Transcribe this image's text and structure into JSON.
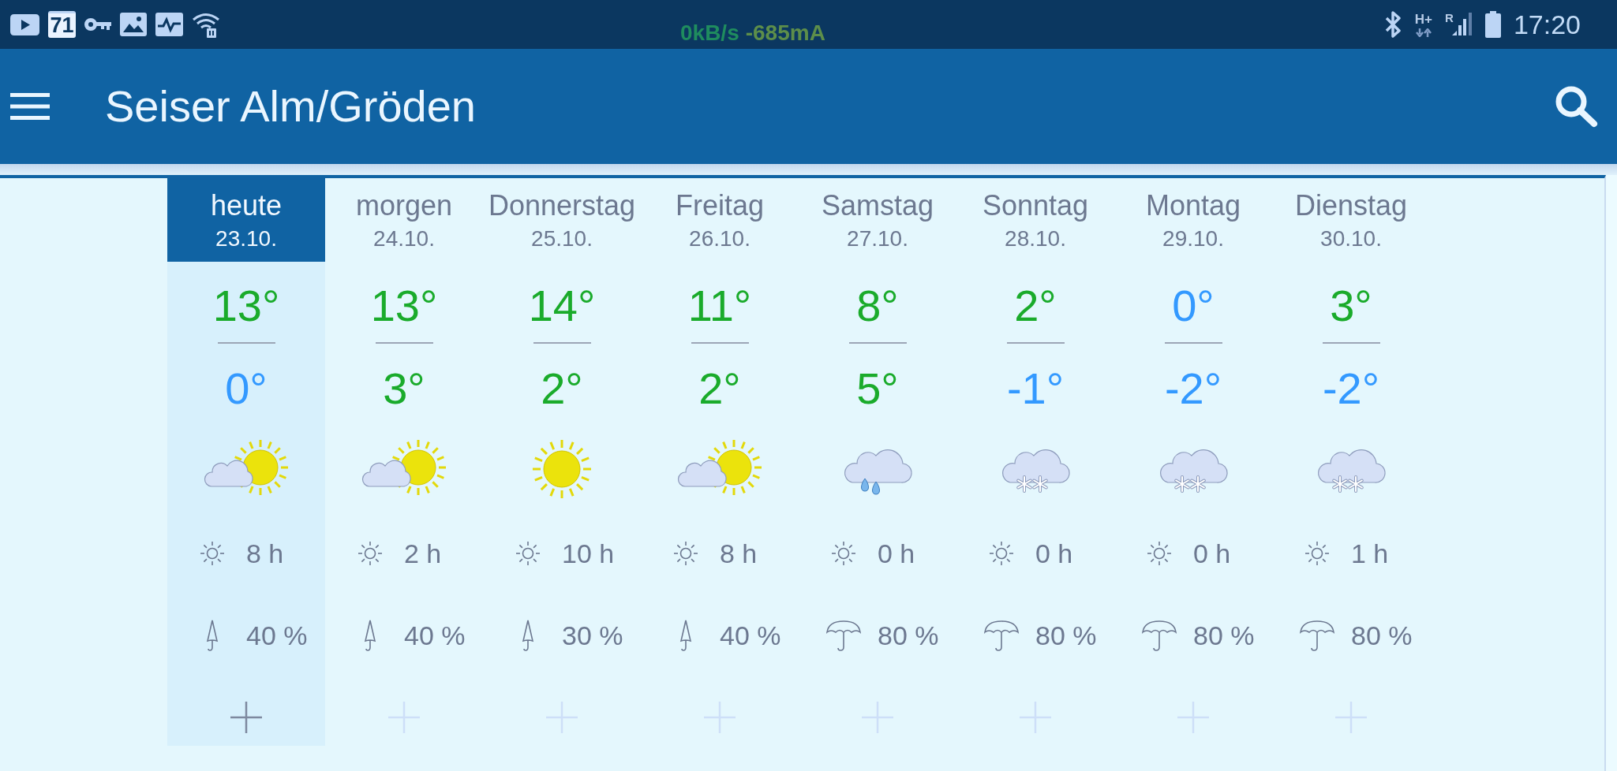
{
  "status_bar": {
    "calendar_day": "71",
    "network_speed": "0kB/s",
    "current_draw": "-685mA",
    "network_type": "H+",
    "roaming": "R",
    "time": "17:20"
  },
  "app_bar": {
    "title": "Seiser Alm/Gröden"
  },
  "forecast": {
    "days": [
      {
        "name": "heute",
        "date": "23.10.",
        "selected": true,
        "high": {
          "text": "13°",
          "color": "#1aab2b"
        },
        "low": {
          "text": "0°",
          "color": "#3399ff"
        },
        "weather_icon": {
          "kind": "partly-sunny"
        },
        "sunshine": "8 h",
        "precipitation": {
          "kind": "closed",
          "text": "40 %"
        }
      },
      {
        "name": "morgen",
        "date": "24.10.",
        "selected": false,
        "high": {
          "text": "13°",
          "color": "#1aab2b"
        },
        "low": {
          "text": "3°",
          "color": "#1aab2b"
        },
        "weather_icon": {
          "kind": "partly-sunny"
        },
        "sunshine": "2 h",
        "precipitation": {
          "kind": "closed",
          "text": "40 %"
        }
      },
      {
        "name": "Donnerstag",
        "date": "25.10.",
        "selected": false,
        "high": {
          "text": "14°",
          "color": "#1aab2b"
        },
        "low": {
          "text": "2°",
          "color": "#1aab2b"
        },
        "weather_icon": {
          "kind": "sunny"
        },
        "sunshine": "10 h",
        "precipitation": {
          "kind": "closed",
          "text": "30 %"
        }
      },
      {
        "name": "Freitag",
        "date": "26.10.",
        "selected": false,
        "high": {
          "text": "11°",
          "color": "#1aab2b"
        },
        "low": {
          "text": "2°",
          "color": "#1aab2b"
        },
        "weather_icon": {
          "kind": "partly-sunny"
        },
        "sunshine": "8 h",
        "precipitation": {
          "kind": "closed",
          "text": "40 %"
        }
      },
      {
        "name": "Samstag",
        "date": "27.10.",
        "selected": false,
        "high": {
          "text": "8°",
          "color": "#1aab2b"
        },
        "low": {
          "text": "5°",
          "color": "#1aab2b"
        },
        "weather_icon": {
          "kind": "rain"
        },
        "sunshine": "0 h",
        "precipitation": {
          "kind": "open",
          "text": "80 %"
        }
      },
      {
        "name": "Sonntag",
        "date": "28.10.",
        "selected": false,
        "high": {
          "text": "2°",
          "color": "#1aab2b"
        },
        "low": {
          "text": "-1°",
          "color": "#3399ff"
        },
        "weather_icon": {
          "kind": "snow"
        },
        "sunshine": "0 h",
        "precipitation": {
          "kind": "open",
          "text": "80 %"
        }
      },
      {
        "name": "Montag",
        "date": "29.10.",
        "selected": false,
        "high": {
          "text": "0°",
          "color": "#3399ff"
        },
        "low": {
          "text": "-2°",
          "color": "#3399ff"
        },
        "weather_icon": {
          "kind": "snow"
        },
        "sunshine": "0 h",
        "precipitation": {
          "kind": "open",
          "text": "80 %"
        }
      },
      {
        "name": "Dienstag",
        "date": "30.10.",
        "selected": false,
        "high": {
          "text": "3°",
          "color": "#1aab2b"
        },
        "low": {
          "text": "-2°",
          "color": "#3399ff"
        },
        "weather_icon": {
          "kind": "snow"
        },
        "sunshine": "1 h",
        "precipitation": {
          "kind": "open",
          "text": "80 %"
        }
      }
    ]
  }
}
